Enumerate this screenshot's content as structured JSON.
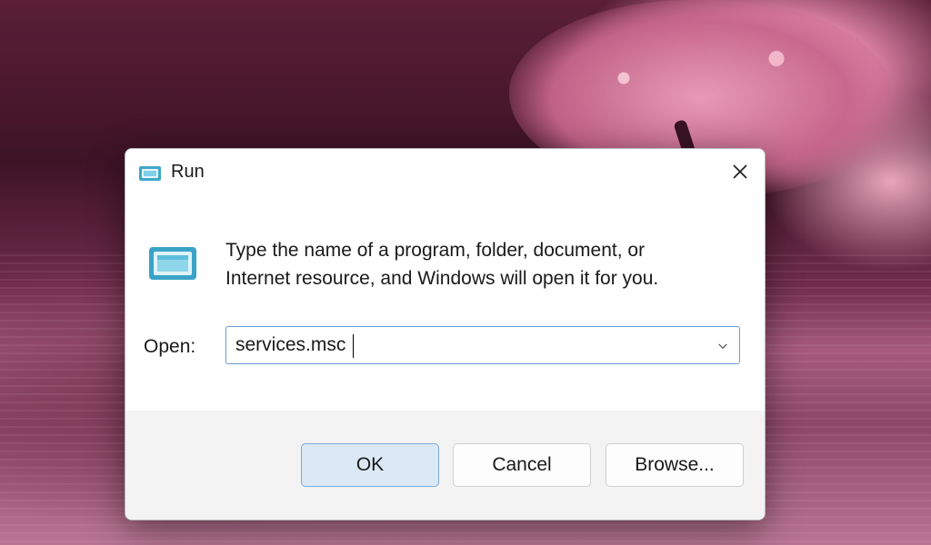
{
  "window": {
    "title": "Run",
    "title_icon": "run-icon",
    "close_icon": "close-icon"
  },
  "message": {
    "line1": "Type the name of a program, folder, document, or",
    "line2": "Internet resource, and Windows will open it for you."
  },
  "open_field": {
    "label": "Open:",
    "value": "services.msc",
    "dropdown_icon": "chevron-down-icon"
  },
  "buttons": {
    "ok": "OK",
    "cancel": "Cancel",
    "browse": "Browse..."
  },
  "colors": {
    "accent_border": "#6a9bd3",
    "primary_button_bg": "#dbe8f5",
    "footer_bg": "#f3f3f3"
  }
}
